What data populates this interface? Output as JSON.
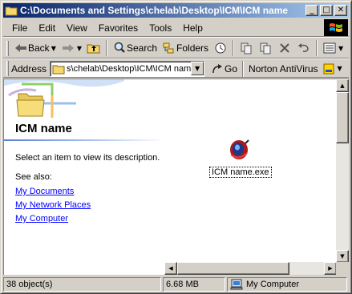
{
  "window": {
    "title": "C:\\Documents and Settings\\chelab\\Desktop\\ICM\\ICM name",
    "minimize": "_",
    "maximize": "□",
    "close": "✕"
  },
  "menu": {
    "items": [
      "File",
      "Edit",
      "View",
      "Favorites",
      "Tools",
      "Help"
    ]
  },
  "toolbar": {
    "back_label": "Back",
    "search_label": "Search",
    "folders_label": "Folders"
  },
  "address": {
    "label": "Address",
    "value": "s\\chelab\\Desktop\\ICM\\ICM name",
    "go_label": "Go",
    "norton_label": "Norton AntiVirus"
  },
  "content": {
    "folder_title": "ICM name",
    "description": "Select an item to view its description.",
    "see_also": "See also:",
    "links": [
      "My Documents",
      "My Network Places",
      "My Computer"
    ],
    "file_label": "ICM name.exe"
  },
  "status": {
    "objects": "38 object(s)",
    "size": "6.68 MB",
    "location": "My Computer"
  },
  "colors": {
    "title_start": "#0a246a",
    "title_end": "#a6caf0",
    "face": "#d4d0c8",
    "link": "#0000ff"
  }
}
